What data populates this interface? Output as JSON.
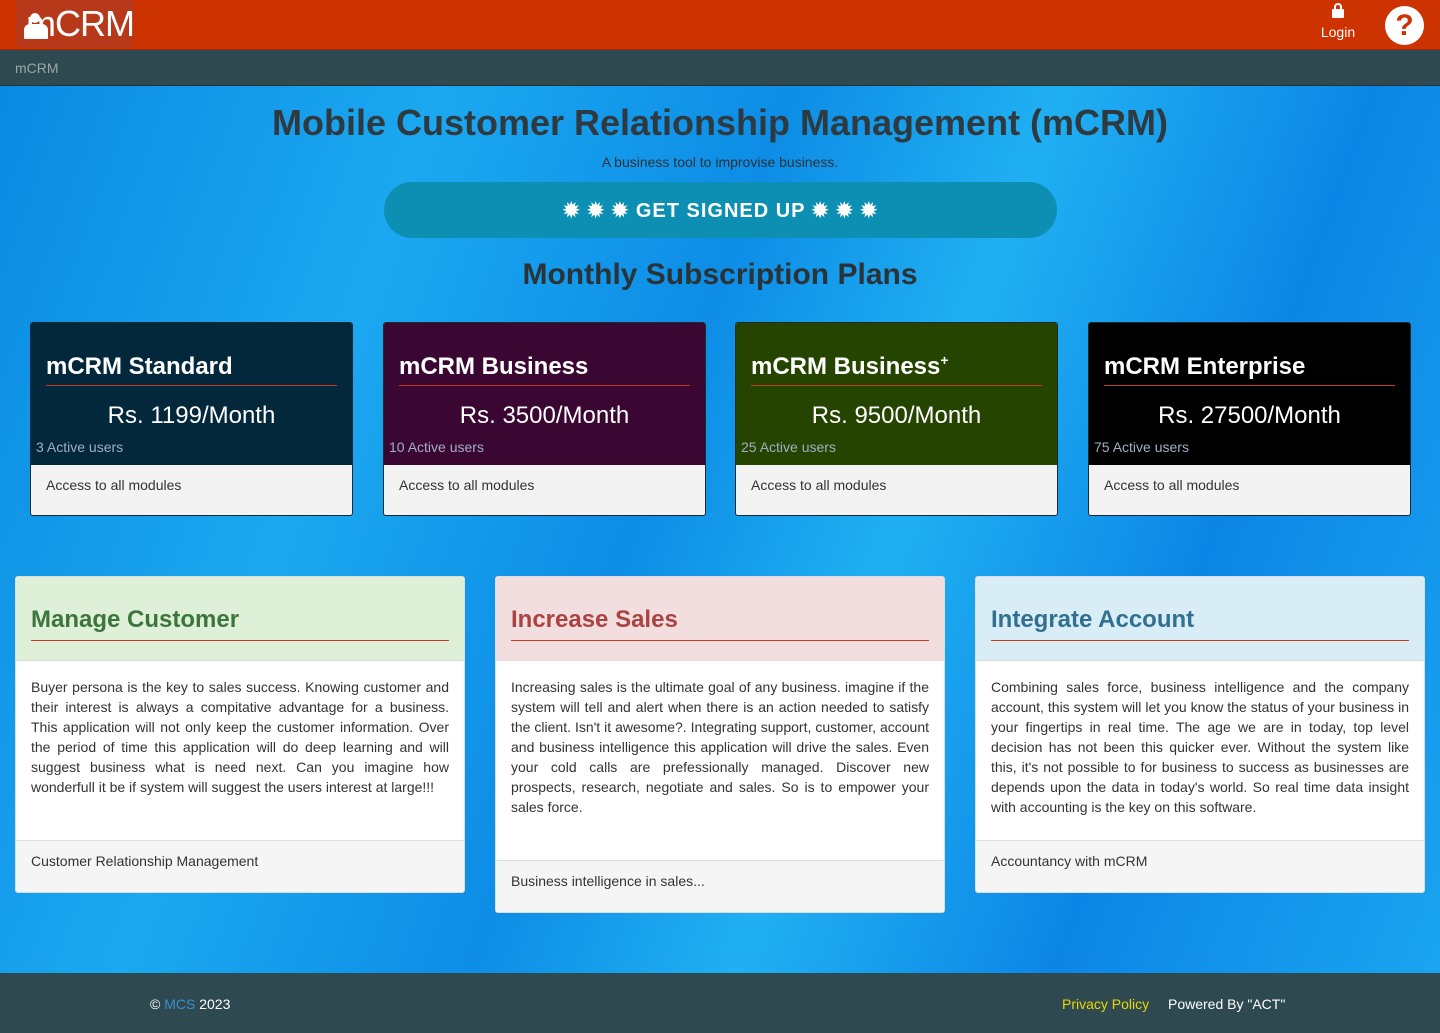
{
  "header": {
    "logo_text": "mCRM",
    "login_label": "Login",
    "help_symbol": "?"
  },
  "breadcrumb": {
    "current": "mCRM"
  },
  "hero": {
    "title": "Mobile Customer Relationship Management (mCRM)",
    "subtitle": "A business tool to improvise business.",
    "signup_label": "✹ ✹ ✹ GET SIGNED UP ✹ ✹ ✹"
  },
  "plans": {
    "title": "Monthly Subscription Plans",
    "items": [
      {
        "name": "mCRM Standard",
        "sup": "",
        "price": "Rs. 1199/Month",
        "users": "3 Active users",
        "feature": "Access to all modules",
        "color": "#03273b"
      },
      {
        "name": "mCRM Business",
        "sup": "",
        "price": "Rs. 3500/Month",
        "users": "10 Active users",
        "feature": "Access to all modules",
        "color": "#3a0632"
      },
      {
        "name": "mCRM Business",
        "sup": "+",
        "price": "Rs. 9500/Month",
        "users": "25 Active users",
        "feature": "Access to all modules",
        "color": "#244400"
      },
      {
        "name": "mCRM Enterprise",
        "sup": "",
        "price": "Rs. 27500/Month",
        "users": "75 Active users",
        "feature": "Access to all modules",
        "color": "#000000"
      }
    ]
  },
  "features": [
    {
      "title": "Manage Customer",
      "head_bg": "#dff0d8",
      "title_color": "#3c763d",
      "body": "Buyer persona is the key to sales success. Knowing customer and their interest is always a compitative advantage for a business. This application will not only keep the customer information. Over the period of time this application will do deep learning and will suggest business what is need next. Can you imagine how wonderfull it be if system will suggest the users interest at large!!!",
      "footer": "Customer Relationship Management"
    },
    {
      "title": "Increase Sales",
      "head_bg": "#f2dede",
      "title_color": "#a94442",
      "body": "Increasing sales is the ultimate goal of any business. imagine if the system will tell and alert when there is an action needed to satisfy the client. Isn't it awesome?. Integrating support, customer, account and business intelligence this application will drive the sales. Even your cold calls are prefessionally managed. Discover new prospects, research, negotiate and sales. So is to empower your sales force.",
      "footer": "Business intelligence in sales..."
    },
    {
      "title": "Integrate Account",
      "head_bg": "#d9edf7",
      "title_color": "#31708f",
      "body": "Combining sales force, business intelligence and the company account, this system will let you know the status of your business in your fingertips in real time. The age we are in today, top level decision has not been this quicker ever. Without the system like this, it's not possible to for business to success as businesses are depends upon the data in today's world. So real time data insight with accounting is the key on this software.",
      "footer": "Accountancy with mCRM"
    }
  ],
  "footer": {
    "copyright_symbol": "©",
    "company_link": "MCS",
    "year": "2023",
    "privacy": "Privacy Policy",
    "powered_by": "Powered By \"ACT\""
  }
}
